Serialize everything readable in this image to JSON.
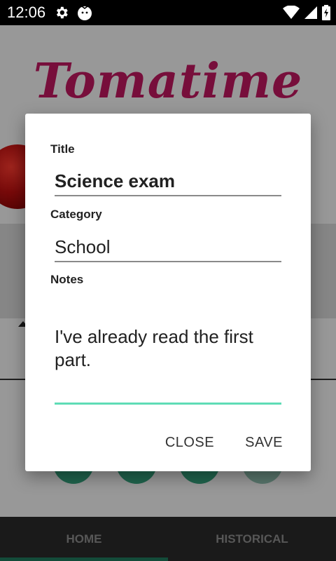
{
  "status_bar": {
    "time": "12:06",
    "icons": [
      "gear-icon",
      "app-notification-icon",
      "wifi-icon",
      "cellular-signal-icon",
      "battery-icon"
    ]
  },
  "app": {
    "logo_text": "Tomatime",
    "bottom_nav": {
      "tabs": [
        {
          "label": "HOME",
          "selected": true
        },
        {
          "label": "HISTORICAL",
          "selected": false
        }
      ]
    }
  },
  "dialog": {
    "title_label": "Title",
    "title_value": "Science exam",
    "category_label": "Category",
    "category_value": "School",
    "notes_label": "Notes",
    "notes_value": "I've already read the first part.",
    "close_label": "CLOSE",
    "save_label": "SAVE"
  },
  "colors": {
    "logo": "#c0185f",
    "accent_underline": "#5fdcb6",
    "nav_indicator": "#1f7a5d"
  }
}
